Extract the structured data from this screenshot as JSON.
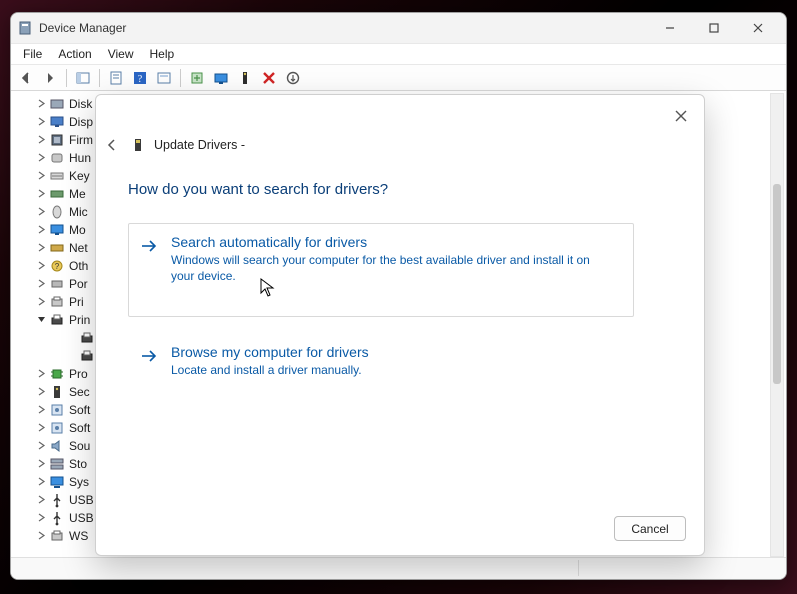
{
  "window": {
    "title": "Device Manager",
    "menus": [
      "File",
      "Action",
      "View",
      "Help"
    ],
    "controls": {
      "minimize": "min",
      "maximize": "max",
      "close": "close"
    }
  },
  "tree": {
    "items": [
      {
        "label": "Disk",
        "expander": ">",
        "icon": "disk"
      },
      {
        "label": "Disp",
        "expander": ">",
        "icon": "display"
      },
      {
        "label": "Firm",
        "expander": ">",
        "icon": "firmware"
      },
      {
        "label": "Hun",
        "expander": ">",
        "icon": "hid"
      },
      {
        "label": "Key",
        "expander": ">",
        "icon": "keyboard"
      },
      {
        "label": "Me",
        "expander": ">",
        "icon": "memory"
      },
      {
        "label": "Mic",
        "expander": ">",
        "icon": "mouse"
      },
      {
        "label": "Mo",
        "expander": ">",
        "icon": "monitor"
      },
      {
        "label": "Net",
        "expander": ">",
        "icon": "network"
      },
      {
        "label": "Oth",
        "expander": ">",
        "icon": "other"
      },
      {
        "label": "Por",
        "expander": ">",
        "icon": "port"
      },
      {
        "label": "Pri",
        "expander": ">",
        "icon": "printqueue"
      },
      {
        "label": "Prin",
        "expander": "v",
        "icon": "printer",
        "expanded": true
      },
      {
        "label": "",
        "expander": "",
        "icon": "printer",
        "child": true
      },
      {
        "label": "",
        "expander": "",
        "icon": "printer",
        "child": true
      },
      {
        "label": "Pro",
        "expander": ">",
        "icon": "processor"
      },
      {
        "label": "Sec",
        "expander": ">",
        "icon": "security"
      },
      {
        "label": "Soft",
        "expander": ">",
        "icon": "software"
      },
      {
        "label": "Soft",
        "expander": ">",
        "icon": "software"
      },
      {
        "label": "Sou",
        "expander": ">",
        "icon": "sound"
      },
      {
        "label": "Sto",
        "expander": ">",
        "icon": "storage"
      },
      {
        "label": "Sys",
        "expander": ">",
        "icon": "system"
      },
      {
        "label": "USB",
        "expander": ">",
        "icon": "usb"
      },
      {
        "label": "USB",
        "expander": ">",
        "icon": "usb"
      },
      {
        "label": "WS",
        "expander": ">",
        "icon": "wsd"
      }
    ]
  },
  "dialog": {
    "title": "Update Drivers -",
    "heading": "How do you want to search for drivers?",
    "opt1": {
      "title": "Search automatically for drivers",
      "desc": "Windows will search your computer for the best available driver and install it on your device."
    },
    "opt2": {
      "title": "Browse my computer for drivers",
      "desc": "Locate and install a driver manually."
    },
    "cancel": "Cancel"
  }
}
